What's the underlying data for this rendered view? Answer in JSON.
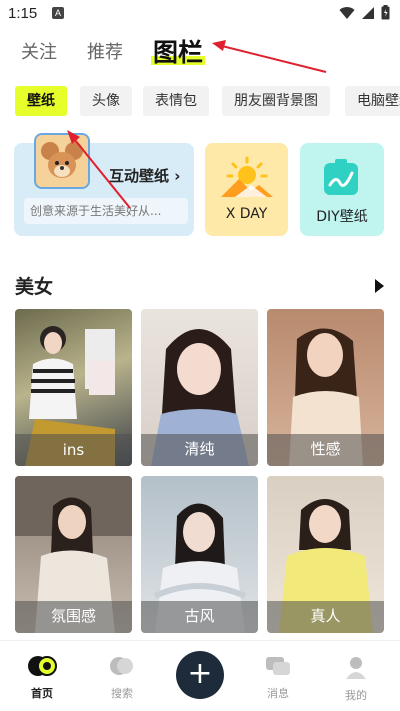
{
  "status": {
    "time": "1:15",
    "notif_letter": "A"
  },
  "top_nav": {
    "tabs": [
      {
        "label": "关注"
      },
      {
        "label": "推荐"
      },
      {
        "label": "图栏"
      }
    ]
  },
  "categories": [
    "壁纸",
    "头像",
    "表情包",
    "朋友圈背景图",
    "电脑壁纸"
  ],
  "features": {
    "interactive": {
      "title": "互动壁纸 ›",
      "desc": "创意来源于生活美好从..."
    },
    "xday": {
      "label": "X DAY"
    },
    "diy": {
      "label": "DIY壁纸"
    }
  },
  "section": {
    "title": "美女"
  },
  "photos": [
    "ins",
    "清纯",
    "性感",
    "氛围感",
    "古风",
    "真人"
  ],
  "bottom_nav": {
    "home": "首页",
    "search": "搜索",
    "messages": "消息",
    "mine": "我的"
  },
  "colors": {
    "accent": "#e6ff2b",
    "annotation": "#e0202e",
    "fab": "#1d2b3a"
  }
}
